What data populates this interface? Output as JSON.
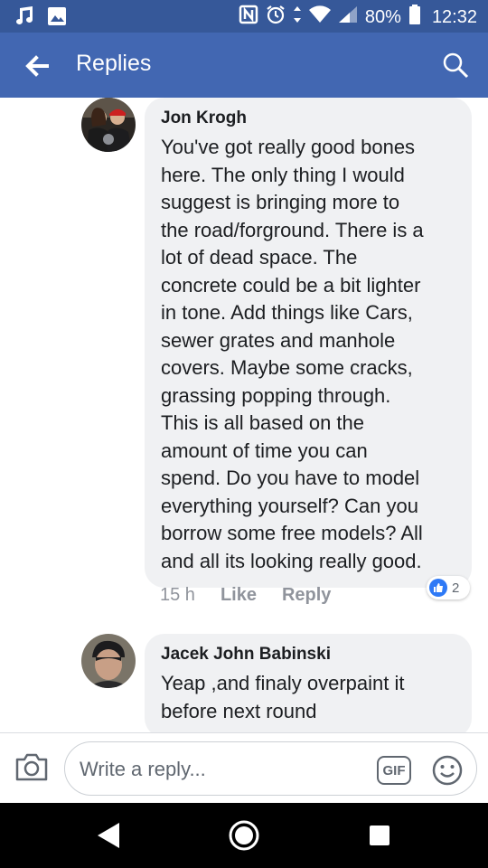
{
  "status_bar": {
    "left_icons": [
      "music-note-icon",
      "image-icon"
    ],
    "right_icons": [
      "nfc-icon",
      "alarm-icon",
      "data-arrows-icon",
      "wifi-icon",
      "signal-icon"
    ],
    "battery": "80%",
    "time": "12:32"
  },
  "header": {
    "title": "Replies",
    "back_icon": "back-arrow-icon",
    "search_icon": "search-icon"
  },
  "comments": [
    {
      "author": "Jon Krogh",
      "text": "You've got really good bones\nhere.  The only thing I would\nsuggest is bringing more to\nthe road/forground.  There is a\nlot of dead space.  The\nconcrete could be a bit lighter\nin tone.  Add things like Cars,\nsewer grates and manhole\ncovers. Maybe some cracks,\ngrassing popping through.\nThis is all based on the\namount of time you can\nspend.  Do you have to model\neverything yourself? Can you\nborrow some free models?  All\nand all its looking really good.",
      "time": "15 h",
      "like_label": "Like",
      "reply_label": "Reply",
      "reaction_count": "2"
    },
    {
      "author": "Jacek John Babinski",
      "text": "Yeap ,and finaly overpaint it\nbefore next round"
    }
  ],
  "composer": {
    "placeholder": "Write a reply...",
    "gif_label": "GIF"
  },
  "colors": {
    "status_bar": "#365899",
    "app_bar": "#4267b2",
    "bubble": "#f0f1f3",
    "like_blue": "#2e79f6",
    "nav_bar": "#000000"
  }
}
